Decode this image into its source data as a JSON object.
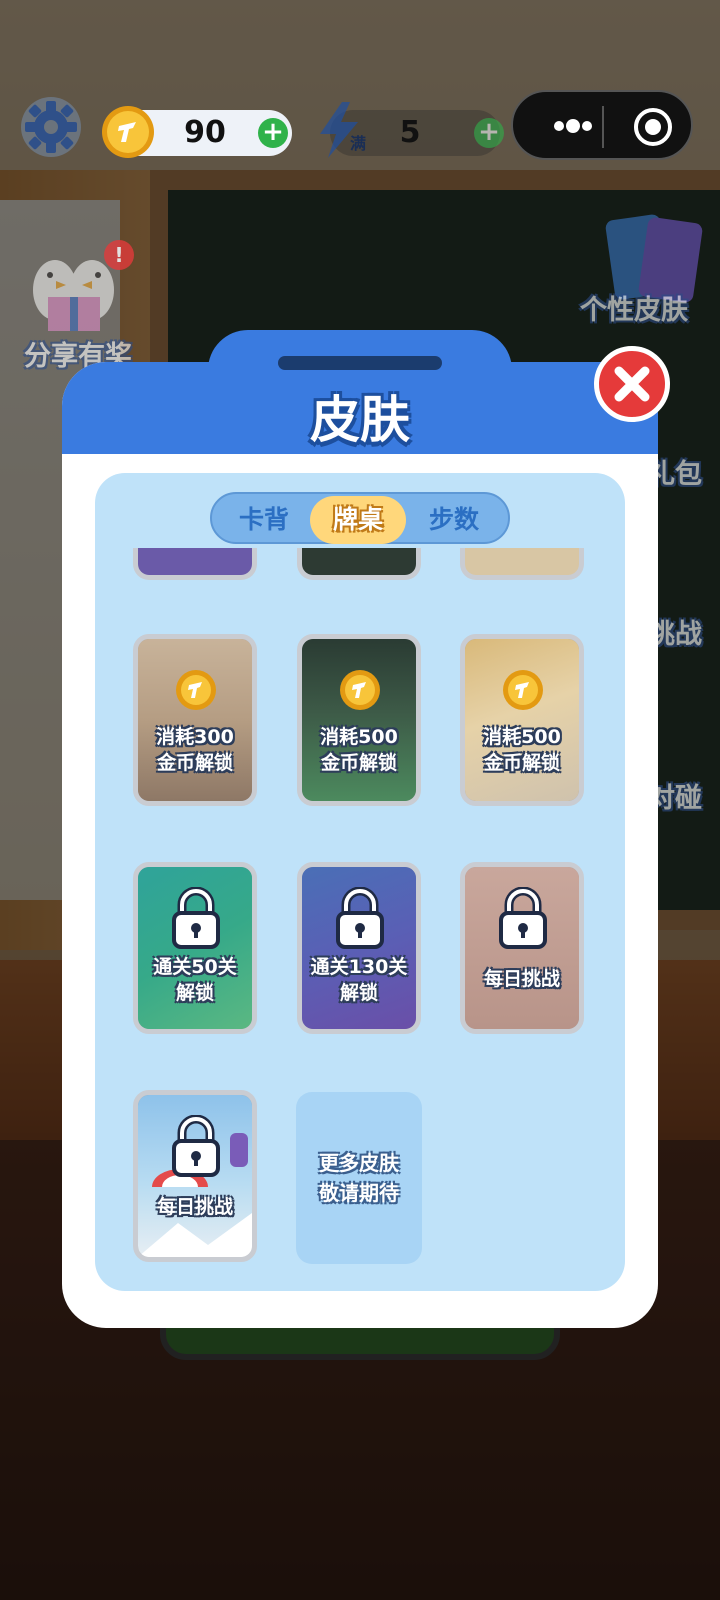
{
  "topbar": {
    "coins": "90",
    "energy": "5",
    "energy_badge": "满"
  },
  "side": {
    "share": "分享有奖",
    "skins": "个性皮肤",
    "gift": "礼包",
    "challenge": "挑战",
    "pvp": "对碰",
    "red_dot": "!"
  },
  "modal": {
    "title": "皮肤",
    "tabs": [
      {
        "label": "卡背",
        "active": false
      },
      {
        "label": "牌桌",
        "active": true
      },
      {
        "label": "步数",
        "active": false
      }
    ]
  },
  "skins": [
    {
      "line1": "消耗300",
      "line2": "金币解锁",
      "type": "coin"
    },
    {
      "line1": "消耗500",
      "line2": "金币解锁",
      "type": "coin"
    },
    {
      "line1": "消耗500",
      "line2": "金币解锁",
      "type": "coin"
    },
    {
      "line1": "通关50关",
      "line2": "解锁",
      "type": "lock"
    },
    {
      "line1": "通关130关",
      "line2": "解锁",
      "type": "lock"
    },
    {
      "line1": "每日挑战",
      "line2": "",
      "type": "lock"
    },
    {
      "line1": "每日挑战",
      "line2": "",
      "type": "lock"
    }
  ],
  "more": {
    "line1": "更多皮肤",
    "line2": "敬请期待"
  },
  "colors": {
    "modal_blue": "#3a7be0",
    "panel_blue": "#bfe2f9",
    "tab_active": "#ffd77b",
    "close_red": "#e53a3a",
    "coin_gold": "#f5b52a"
  }
}
